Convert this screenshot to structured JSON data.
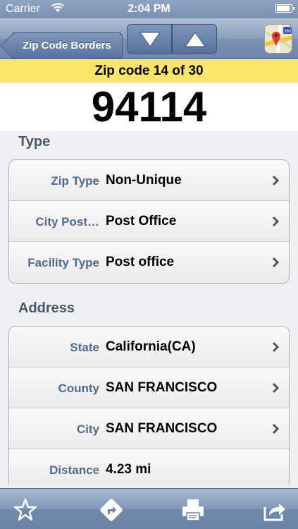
{
  "status_bar": {
    "carrier": "Carrier",
    "time": "2:04 PM",
    "battery_level": 0.95
  },
  "nav": {
    "back_label": "Zip Code Borders",
    "down_icon": "triangle-down-icon",
    "up_icon": "triangle-up-icon",
    "map_icon": "maps-app-icon",
    "map_badge": "280"
  },
  "header": {
    "position_label": "Zip code 14 of 30",
    "zip_code": "94114"
  },
  "sections": {
    "type": {
      "title": "Type",
      "rows": [
        {
          "label": "Zip Type",
          "value": "Non-Unique"
        },
        {
          "label": "City Post…",
          "value": "Post Office"
        },
        {
          "label": "Facility Type",
          "value": "Post office"
        }
      ]
    },
    "address": {
      "title": "Address",
      "rows": [
        {
          "label": "State",
          "value": "California(CA)"
        },
        {
          "label": "County",
          "value": "SAN FRANCISCO"
        },
        {
          "label": "City",
          "value": "SAN FRANCISCO"
        },
        {
          "label": "Distance",
          "value": "4.23 mi"
        }
      ]
    }
  },
  "toolbar": {
    "icons": [
      "star-icon",
      "directions-icon",
      "print-icon",
      "share-icon"
    ]
  },
  "colors": {
    "header_yellow": "#fce46a",
    "label_blue": "#4d6a96",
    "nav_blue": "#7b91b2"
  }
}
